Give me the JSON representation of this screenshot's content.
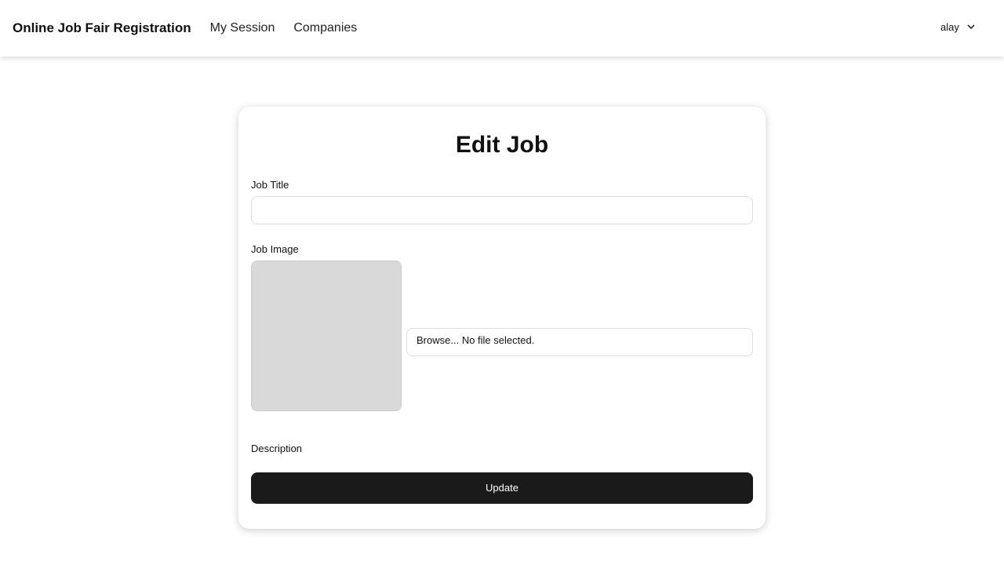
{
  "nav": {
    "brand": "Online Job Fair Registration",
    "links": [
      "My Session",
      "Companies"
    ],
    "user": "alay"
  },
  "form": {
    "title": "Edit Job",
    "job_title_label": "Job Title",
    "job_title_value": "",
    "job_image_label": "Job Image",
    "file_browse": "Browse...",
    "file_status": "No file selected.",
    "description_label": "Description",
    "submit": "Update"
  }
}
